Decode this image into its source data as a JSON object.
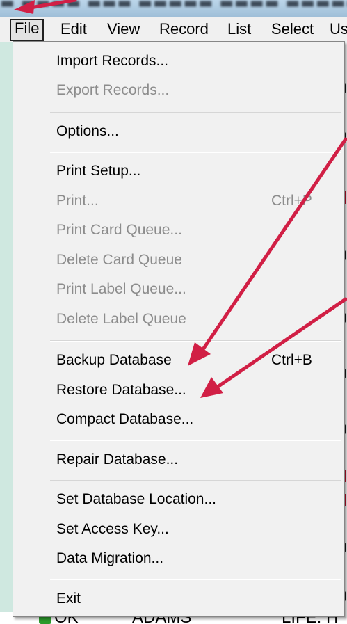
{
  "menubar": {
    "items": [
      "File",
      "Edit",
      "View",
      "Record",
      "List",
      "Select",
      "Us"
    ],
    "active": "File"
  },
  "file_menu": {
    "items": [
      {
        "label": "Import Records...",
        "enabled": true
      },
      {
        "label": "Export Records...",
        "enabled": false
      },
      {
        "label": "Options...",
        "enabled": true
      },
      {
        "label": "Print Setup...",
        "enabled": true
      },
      {
        "label": "Print...",
        "enabled": false,
        "shortcut": "Ctrl+P"
      },
      {
        "label": "Print Card Queue...",
        "enabled": false
      },
      {
        "label": "Delete Card Queue",
        "enabled": false
      },
      {
        "label": "Print Label Queue...",
        "enabled": false
      },
      {
        "label": "Delete Label Queue",
        "enabled": false
      },
      {
        "label": "Backup Database",
        "enabled": true,
        "shortcut": "Ctrl+B"
      },
      {
        "label": "Restore Database...",
        "enabled": true
      },
      {
        "label": "Compact Database...",
        "enabled": true
      },
      {
        "label": "Repair Database...",
        "enabled": true
      },
      {
        "label": "Set Database Location...",
        "enabled": true
      },
      {
        "label": "Set Access Key...",
        "enabled": true
      },
      {
        "label": "Data Migration...",
        "enabled": true
      },
      {
        "label": "Exit",
        "enabled": true
      }
    ]
  },
  "background_row": {
    "col1": "OK",
    "col2": "ADAMS",
    "col3": "LIFE. H"
  },
  "colors": {
    "annotation_arrow": "#d11f45",
    "disabled_text": "#8c8c8c",
    "menu_bg": "#f1f1f1"
  }
}
